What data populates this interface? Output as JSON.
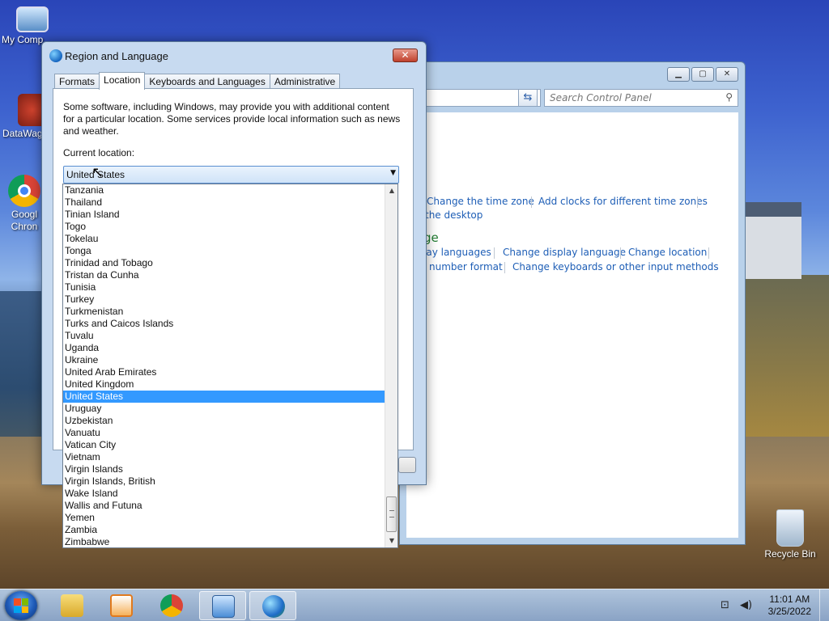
{
  "desktop": {
    "icons": [
      {
        "label": "My Comp",
        "icon": "computer-icon"
      },
      {
        "label": "DataWag",
        "icon": "app-shortcut-icon"
      },
      {
        "label": "Googl Chron",
        "icon": "chrome-icon"
      },
      {
        "label": "Recycle Bin",
        "icon": "recycle-bin-icon"
      }
    ]
  },
  "control_panel": {
    "search_placeholder": "Search Control Panel",
    "links": {
      "change_time_zone": "Change the time zone",
      "add_clocks": "Add clocks for different time zones",
      "the_desktop": "the desktop",
      "heading_fragment": "ge",
      "display_languages": "lay languages",
      "change_display_language": "Change display language",
      "change_location": "Change location",
      "number_format": "number format",
      "change_keyboards": "Change keyboards or other input methods"
    }
  },
  "dialog": {
    "title": "Region and Language",
    "tabs": [
      {
        "label": "Formats",
        "active": false
      },
      {
        "label": "Location",
        "active": true
      },
      {
        "label": "Keyboards and Languages",
        "active": false
      },
      {
        "label": "Administrative",
        "active": false
      }
    ],
    "description": "Some software, including Windows, may provide you with additional content for a particular location. Some services provide local information such as news and weather.",
    "current_location_label": "Current location:",
    "current_location_value": "United States"
  },
  "location_list": {
    "items": [
      "Tanzania",
      "Thailand",
      "Tinian Island",
      "Togo",
      "Tokelau",
      "Tonga",
      "Trinidad and Tobago",
      "Tristan da Cunha",
      "Tunisia",
      "Turkey",
      "Turkmenistan",
      "Turks and Caicos Islands",
      "Tuvalu",
      "Uganda",
      "Ukraine",
      "United Arab Emirates",
      "United Kingdom",
      "United States",
      "Uruguay",
      "Uzbekistan",
      "Vanuatu",
      "Vatican City",
      "Vietnam",
      "Virgin Islands",
      "Virgin Islands, British",
      "Wake Island",
      "Wallis and Futuna",
      "Yemen",
      "Zambia",
      "Zimbabwe"
    ],
    "selected": "United States"
  },
  "taskbar": {
    "buttons": [
      {
        "name": "explorer-taskbar-button",
        "icon": "folder-icon",
        "color": "#e8c24a"
      },
      {
        "name": "media-player-taskbar-button",
        "icon": "media-player-icon",
        "color": "#f08a24"
      },
      {
        "name": "chrome-taskbar-button",
        "icon": "chrome-icon",
        "color": "#db4437"
      },
      {
        "name": "control-panel-taskbar-button",
        "icon": "control-panel-icon",
        "color": "#5a9be0"
      },
      {
        "name": "region-language-taskbar-button",
        "icon": "globe-icon",
        "color": "#2f8f3f"
      }
    ],
    "time": "11:01 AM",
    "date": "3/25/2022"
  },
  "colors": {
    "selection": "#3399ff",
    "link": "#1e5eb6",
    "close_button": "#c0412d"
  }
}
